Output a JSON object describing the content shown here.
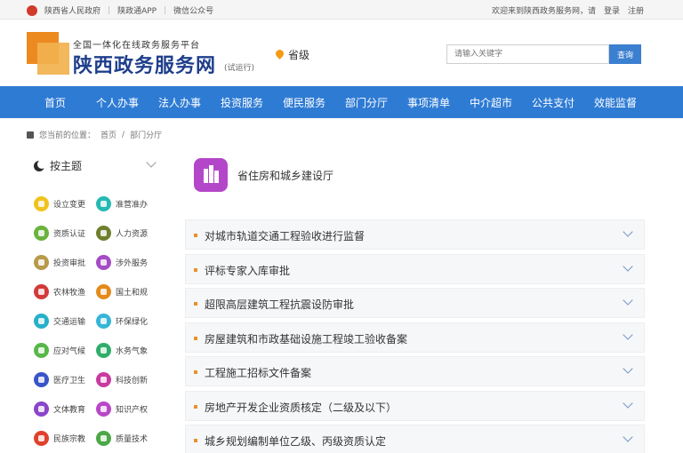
{
  "topbar": {
    "links": [
      "陕西省人民政府",
      "陕政通APP",
      "微信公众号"
    ],
    "welcome": "欢迎来到陕西政务服务网，请",
    "login": "登录",
    "register": "注册"
  },
  "header": {
    "subtitle": "全国一体化在线政务服务平台",
    "title": "陕西政务服务网",
    "trial": "(试运行)",
    "region": "省级",
    "search_placeholder": "请输入关键字",
    "search_button": "查询"
  },
  "nav": [
    "首页",
    "个人办事",
    "法人办事",
    "投资服务",
    "便民服务",
    "部门分厅",
    "事项清单",
    "中介超市",
    "公共支付",
    "效能监督"
  ],
  "breadcrumb": {
    "prefix": "您当前的位置：",
    "home": "首页",
    "current": "部门分厅"
  },
  "sidebar": {
    "heading": "按主题",
    "categories": [
      {
        "label": "设立变更",
        "color": "#f0c31d"
      },
      {
        "label": "准营准办",
        "color": "#25b9b3"
      },
      {
        "label": "资质认证",
        "color": "#6ab33e"
      },
      {
        "label": "人力资源",
        "color": "#6f7f2e"
      },
      {
        "label": "投资审批",
        "color": "#b89a4a"
      },
      {
        "label": "涉外服务",
        "color": "#a54cc7"
      },
      {
        "label": "农林牧渔",
        "color": "#d33a3a"
      },
      {
        "label": "国土和规",
        "color": "#e48a1b"
      },
      {
        "label": "交通运输",
        "color": "#27b0c9"
      },
      {
        "label": "环保绿化",
        "color": "#35b5d8"
      },
      {
        "label": "应对气候",
        "color": "#56b848"
      },
      {
        "label": "水务气象",
        "color": "#2fae6a"
      },
      {
        "label": "医疗卫生",
        "color": "#3a55c8"
      },
      {
        "label": "科技创新",
        "color": "#c93aa0"
      },
      {
        "label": "文体教育",
        "color": "#8a45c9"
      },
      {
        "label": "知识产权",
        "color": "#b947c9"
      },
      {
        "label": "民族宗教",
        "color": "#e0412c"
      },
      {
        "label": "质量技术",
        "color": "#4ca846"
      }
    ]
  },
  "department": {
    "name": "省住房和城乡建设厅",
    "icon_color": "#b447c9",
    "items": [
      "对城市轨道交通工程验收进行监督",
      "评标专家入库审批",
      "超限高层建筑工程抗震设防审批",
      "房屋建筑和市政基础设施工程竣工验收备案",
      "工程施工招标文件备案",
      "房地产开发企业资质核定（二级及以下）",
      "城乡规划编制单位乙级、丙级资质认定"
    ]
  },
  "colors": {
    "brand_blue": "#2e7bd4",
    "accent_orange": "#ec8a1f",
    "title_blue": "#1f3f8c"
  }
}
